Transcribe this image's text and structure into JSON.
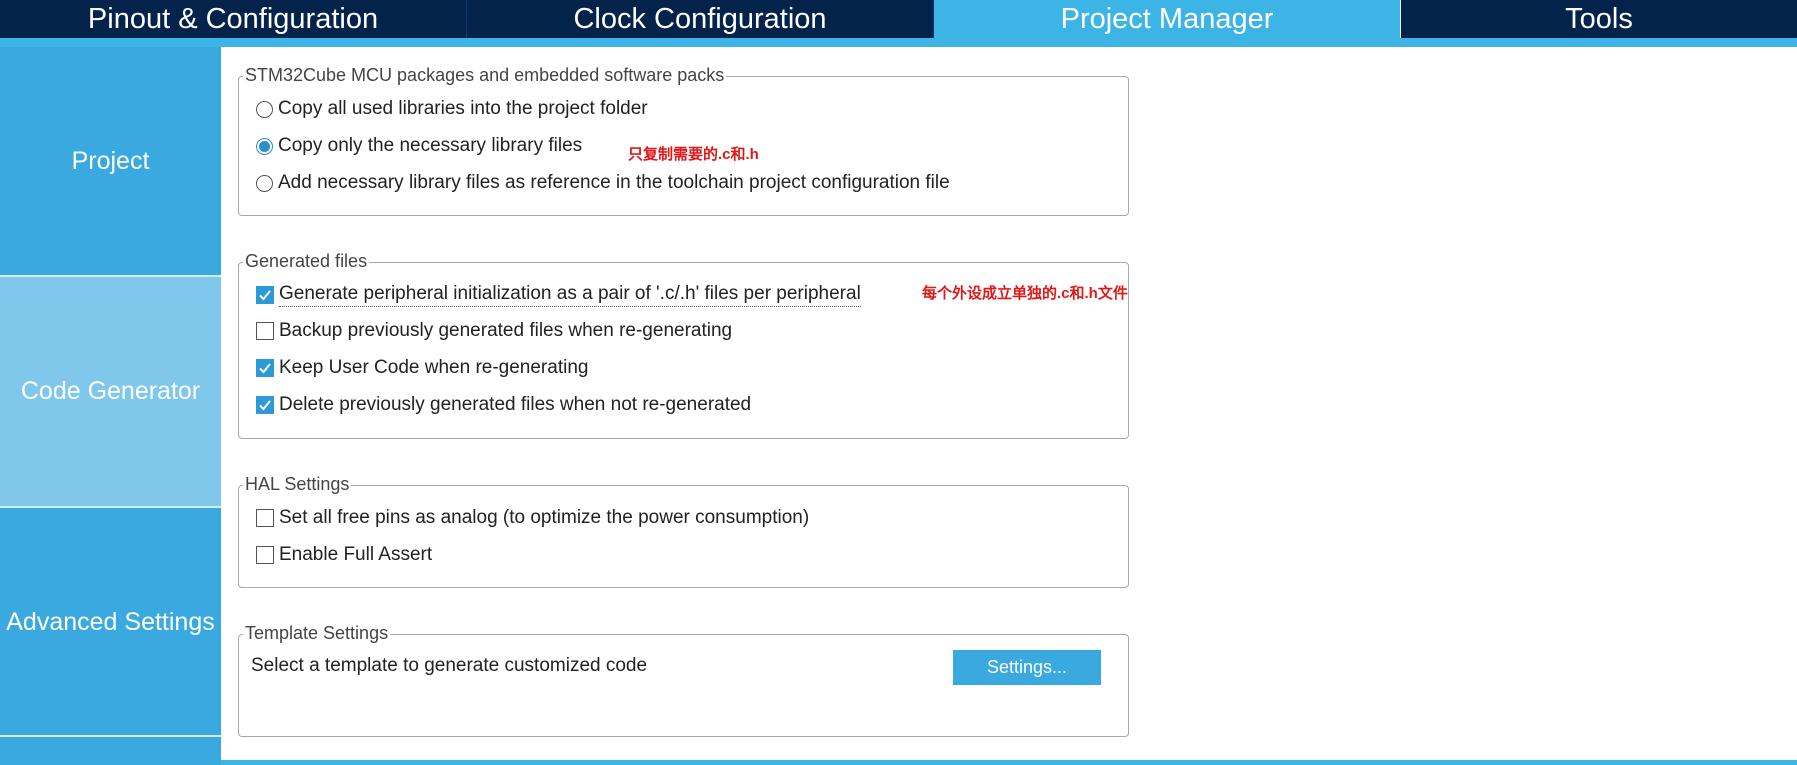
{
  "top_tabs": [
    {
      "label": "Pinout & Configuration"
    },
    {
      "label": "Clock Configuration"
    },
    {
      "label": "Project Manager"
    },
    {
      "label": "Tools"
    }
  ],
  "sidebar": {
    "items": [
      {
        "label": "Project"
      },
      {
        "label": "Code Generator"
      },
      {
        "label": "Advanced Settings"
      }
    ]
  },
  "packages_group": {
    "legend": "STM32Cube MCU packages and embedded software packs",
    "options": [
      {
        "label": "Copy all used libraries into the project folder",
        "selected": false
      },
      {
        "label": "Copy only the necessary library files",
        "selected": true
      },
      {
        "label": "Add necessary library files as reference in the toolchain project configuration file",
        "selected": false
      }
    ],
    "annotation": "只复制需要的.c和.h"
  },
  "generated_files_group": {
    "legend": "Generated files",
    "options": [
      {
        "label": "Generate peripheral initialization as a pair of '.c/.h' files per peripheral",
        "checked": true
      },
      {
        "label": "Backup previously generated files when re-generating",
        "checked": false
      },
      {
        "label": "Keep User Code when re-generating",
        "checked": true
      },
      {
        "label": "Delete previously generated files when not re-generated",
        "checked": true
      }
    ],
    "annotation": "每个外设成立单独的.c和.h文件"
  },
  "hal_group": {
    "legend": "HAL Settings",
    "options": [
      {
        "label": "Set all free pins as analog (to optimize the power consumption)",
        "checked": false
      },
      {
        "label": "Enable Full Assert",
        "checked": false
      }
    ]
  },
  "template_group": {
    "legend": "Template Settings",
    "text": "Select a template to generate customized code",
    "button_label": "Settings..."
  },
  "colors": {
    "topbar": "#03234b",
    "accent": "#3cb4e6",
    "sidebar": "#3aa9df",
    "sidebar_active": "#7fc8ec",
    "check": "#2b9ad6",
    "annotation": "#e01818"
  }
}
